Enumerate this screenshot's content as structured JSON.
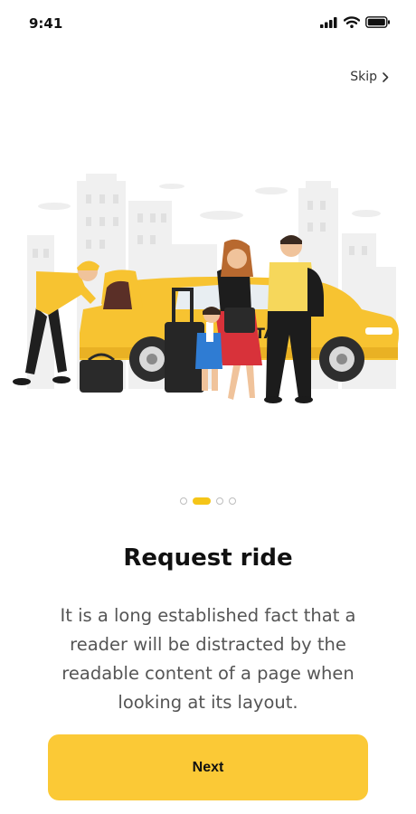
{
  "status_bar": {
    "time": "9:41"
  },
  "header": {
    "skip_label": "Skip"
  },
  "pagination": {
    "count": 4,
    "active_index": 1
  },
  "content": {
    "title": "Request ride",
    "description": "It is a long established fact that a reader will be distracted by the readable content of a page when looking at its layout."
  },
  "actions": {
    "next_label": "Next"
  },
  "colors": {
    "accent": "#fbc936",
    "text_primary": "#111111",
    "text_secondary": "#555555"
  },
  "icons": {
    "status": [
      "signal-icon",
      "wifi-icon",
      "battery-icon"
    ],
    "skip": "chevron-right-icon"
  },
  "illustration": {
    "subject": "taxi-driver-loading-luggage-for-family",
    "car_text": "TA"
  }
}
